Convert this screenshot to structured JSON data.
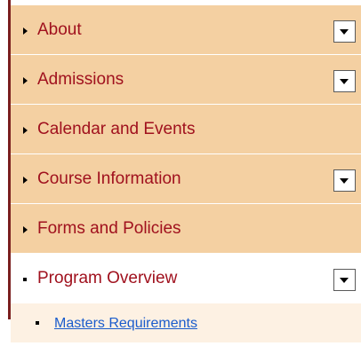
{
  "menu": {
    "items": [
      {
        "label": "About",
        "has_toggle": true
      },
      {
        "label": "Admissions",
        "has_toggle": true
      },
      {
        "label": "Calendar and Events",
        "has_toggle": false
      },
      {
        "label": "Course Information",
        "has_toggle": true
      },
      {
        "label": "Forms and Policies",
        "has_toggle": false
      },
      {
        "label": "Program Overview",
        "has_toggle": true,
        "active": true
      }
    ],
    "subitems": [
      {
        "label": "Masters Requirements"
      }
    ]
  },
  "colors": {
    "item_bg": "#f4d0a2",
    "active_bg": "#ffffff",
    "label_color": "#a0111e",
    "subitem_bg": "#fdf1e3",
    "link_color": "#1a5ccc",
    "left_bar": "#7a1e1e"
  },
  "icons": {
    "collapsed_bullet": "triangle-right-icon",
    "active_bullet": "square-bullet-icon",
    "toggle": "dropdown-arrow-icon"
  }
}
